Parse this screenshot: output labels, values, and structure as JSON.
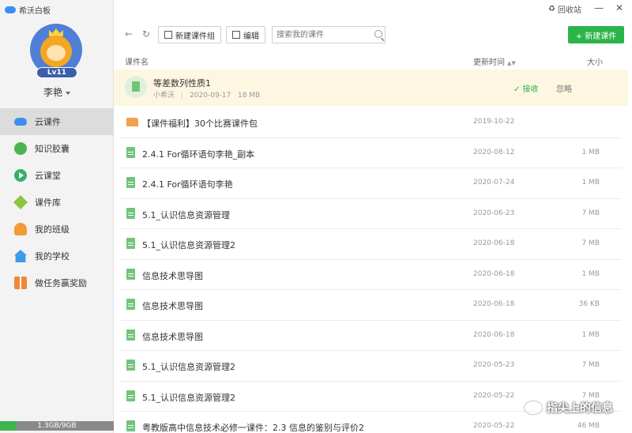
{
  "app": {
    "title": "希沃白板"
  },
  "user": {
    "name": "李艳",
    "level": "Lv11"
  },
  "sidebar": {
    "items": [
      {
        "label": "云课件",
        "icon": "cloud-icon",
        "active": true
      },
      {
        "label": "知识胶囊",
        "icon": "capsule-icon",
        "active": false
      },
      {
        "label": "云课堂",
        "icon": "play-circle-icon",
        "active": false
      },
      {
        "label": "课件库",
        "icon": "diamond-icon",
        "active": false
      },
      {
        "label": "我的班级",
        "icon": "people-icon",
        "active": false
      },
      {
        "label": "我的学校",
        "icon": "school-icon",
        "active": false
      },
      {
        "label": "做任务赢奖励",
        "icon": "gift-icon",
        "active": false
      }
    ],
    "storage": {
      "text": "1.3GB/9GB",
      "used_fraction": 0.144
    }
  },
  "topbar": {
    "recycle_label": "回收站",
    "minimize": "—",
    "close": "✕"
  },
  "toolbar": {
    "back": "←",
    "refresh": "↻",
    "new_group_label": "新建课件组",
    "edit_label": "编辑",
    "search_placeholder": "搜索我的课件",
    "new_course_label": "+ 新建课件"
  },
  "list_header": {
    "name": "课件名",
    "updated": "更新时间",
    "size": "大小"
  },
  "share_banner": {
    "title": "等差数列性质1",
    "sender": "小希沃",
    "date": "2020-09-17",
    "size": "18 MB",
    "accept_label": "✓ 接收",
    "ignore_label": "忽略"
  },
  "files": [
    {
      "name": "【课件福利】30个比赛课件包",
      "date": "2019-10-22",
      "size": "",
      "type": "folder"
    },
    {
      "name": "2.4.1 For循环语句李艳_副本",
      "date": "2020-08-12",
      "size": "1 MB",
      "type": "file"
    },
    {
      "name": "2.4.1 For循环语句李艳",
      "date": "2020-07-24",
      "size": "1 MB",
      "type": "file"
    },
    {
      "name": "5.1_认识信息资源管理",
      "date": "2020-06-23",
      "size": "7 MB",
      "type": "file"
    },
    {
      "name": "5.1_认识信息资源管理2",
      "date": "2020-06-18",
      "size": "7 MB",
      "type": "file"
    },
    {
      "name": "信息技术思导图",
      "date": "2020-06-18",
      "size": "1 MB",
      "type": "file"
    },
    {
      "name": "信息技术思导图",
      "date": "2020-06-18",
      "size": "36 KB",
      "type": "file"
    },
    {
      "name": "信息技术思导图",
      "date": "2020-06-18",
      "size": "1 MB",
      "type": "file"
    },
    {
      "name": "5.1_认识信息资源管理2",
      "date": "2020-05-23",
      "size": "7 MB",
      "type": "file"
    },
    {
      "name": "5.1_认识信息资源管理2",
      "date": "2020-05-22",
      "size": "7 MB",
      "type": "file"
    },
    {
      "name": "粤教版高中信息技术必修一课件：2.3 信息的鉴别与评价2",
      "date": "2020-05-22",
      "size": "46 MB",
      "type": "file"
    }
  ],
  "watermark": "指尖上的信息"
}
